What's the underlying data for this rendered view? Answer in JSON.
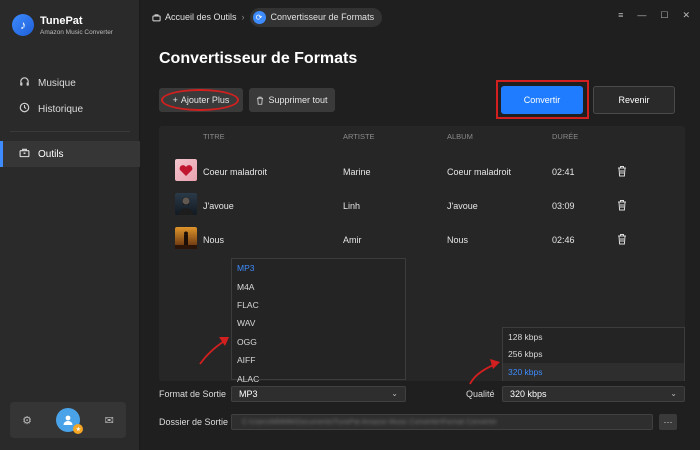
{
  "app": {
    "name": "TunePat",
    "subtitle": "Amazon Music Converter"
  },
  "sidebar": {
    "items": [
      {
        "label": "Musique",
        "icon": "headphones-icon"
      },
      {
        "label": "Historique",
        "icon": "clock-icon"
      },
      {
        "label": "Outils",
        "icon": "toolbox-icon",
        "active": true
      }
    ],
    "bottom_icons": [
      "gear-icon",
      "avatar",
      "mail-icon"
    ]
  },
  "breadcrumb": {
    "home": "Accueil des Outils",
    "current": "Convertisseur de Formats"
  },
  "page": {
    "title": "Convertisseur de Formats"
  },
  "toolbar": {
    "add_label": "Ajouter Plus",
    "delete_label": "Supprimer tout",
    "convert_label": "Convertir",
    "back_label": "Revenir"
  },
  "table": {
    "headers": [
      "TITRE",
      "ARTISTE",
      "ALBUM",
      "DURÉE"
    ],
    "rows": [
      {
        "title": "Coeur maladroit",
        "artist": "Marine",
        "album": "Coeur maladroit",
        "duration": "02:41"
      },
      {
        "title": "J'avoue",
        "artist": "Linh",
        "album": "J'avoue",
        "duration": "03:09"
      },
      {
        "title": "Nous",
        "artist": "Amir",
        "album": "Nous",
        "duration": "02:46"
      }
    ]
  },
  "format": {
    "label": "Format de Sortie",
    "value": "MP3",
    "options": [
      "MP3",
      "M4A",
      "FLAC",
      "WAV",
      "OGG",
      "AIFF",
      "ALAC"
    ]
  },
  "quality": {
    "label": "Qualité",
    "value": "320 kbps",
    "options": [
      "128 kbps",
      "256 kbps",
      "320 kbps"
    ]
  },
  "output_folder": {
    "label": "Dossier de Sortie",
    "value": "C:\\Users\\MMMM\\Documents\\TunePat Amazon Music Converter\\Format Converter",
    "browse_label": "···"
  },
  "colors": {
    "accent": "#1f7cff",
    "highlight": "#d21f1f",
    "background": "#1f1f1f",
    "sidebar": "#2a2a2a"
  }
}
